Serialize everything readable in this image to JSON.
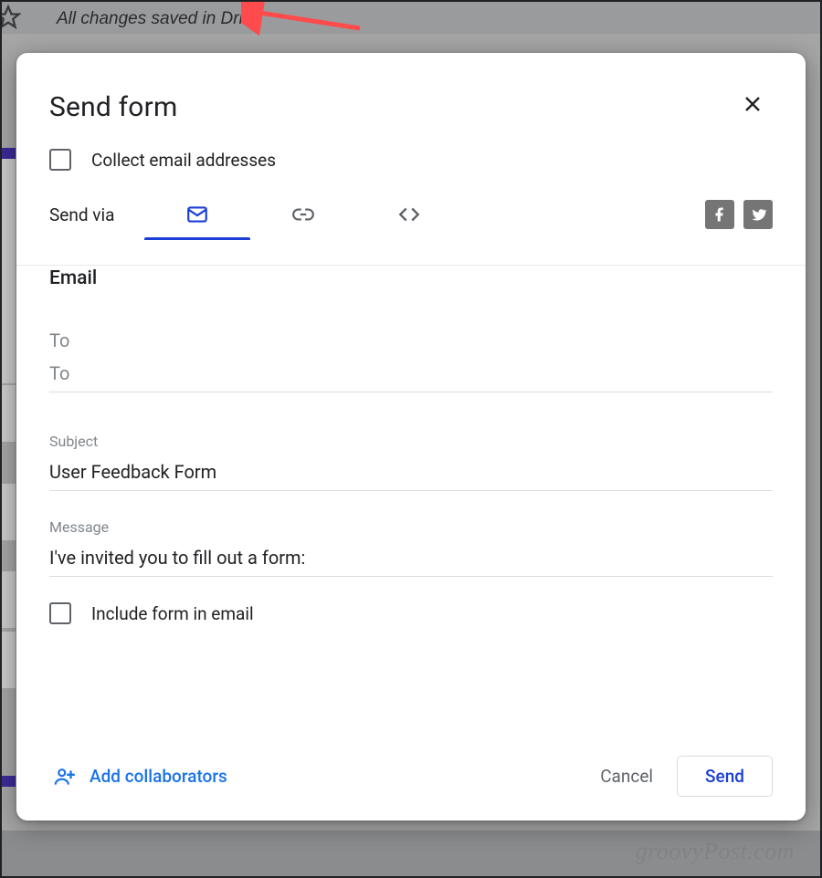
{
  "background": {
    "saved_text": "All changes saved in Drive",
    "watermark": "groovyPost.com"
  },
  "dialog": {
    "title": "Send form",
    "collect_email_label": "Collect email addresses",
    "send_via_label": "Send via",
    "tabs": {
      "email_icon": "email-icon",
      "link_icon": "link-icon",
      "embed_icon": "embed-icon"
    },
    "social": {
      "facebook": "facebook-icon",
      "twitter": "twitter-icon"
    },
    "section_head": "Email",
    "fields": {
      "to_label": "To",
      "to_value": "",
      "subject_label": "Subject",
      "subject_value": "User Feedback Form",
      "message_label": "Message",
      "message_value": "I've invited you to fill out a form:"
    },
    "include_form_label": "Include form in email",
    "footer": {
      "add_collaborators": "Add collaborators",
      "cancel": "Cancel",
      "send": "Send"
    }
  }
}
